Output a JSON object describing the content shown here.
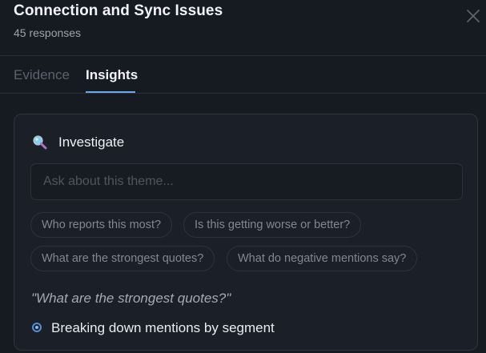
{
  "header": {
    "title": "Connection and Sync Issues",
    "subtitle": "45 responses",
    "close_icon": "close-icon"
  },
  "tabs": [
    {
      "label": "Evidence",
      "active": false
    },
    {
      "label": "Insights",
      "active": true
    }
  ],
  "investigate": {
    "icon": "magnifier-icon",
    "title": "Investigate",
    "input": {
      "value": "",
      "placeholder": "Ask about this theme..."
    },
    "suggestions": [
      "Who reports this most?",
      "Is this getting worse or better?",
      "What are the strongest quotes?",
      "What do negative mentions say?"
    ],
    "current_question": "\"What are the strongest quotes?\"",
    "status": "Breaking down mentions by segment"
  },
  "colors": {
    "background": "#161a21",
    "panel": "#1b1f27",
    "accent": "#6aa7ec",
    "status_dot": "#4f8ddb"
  }
}
